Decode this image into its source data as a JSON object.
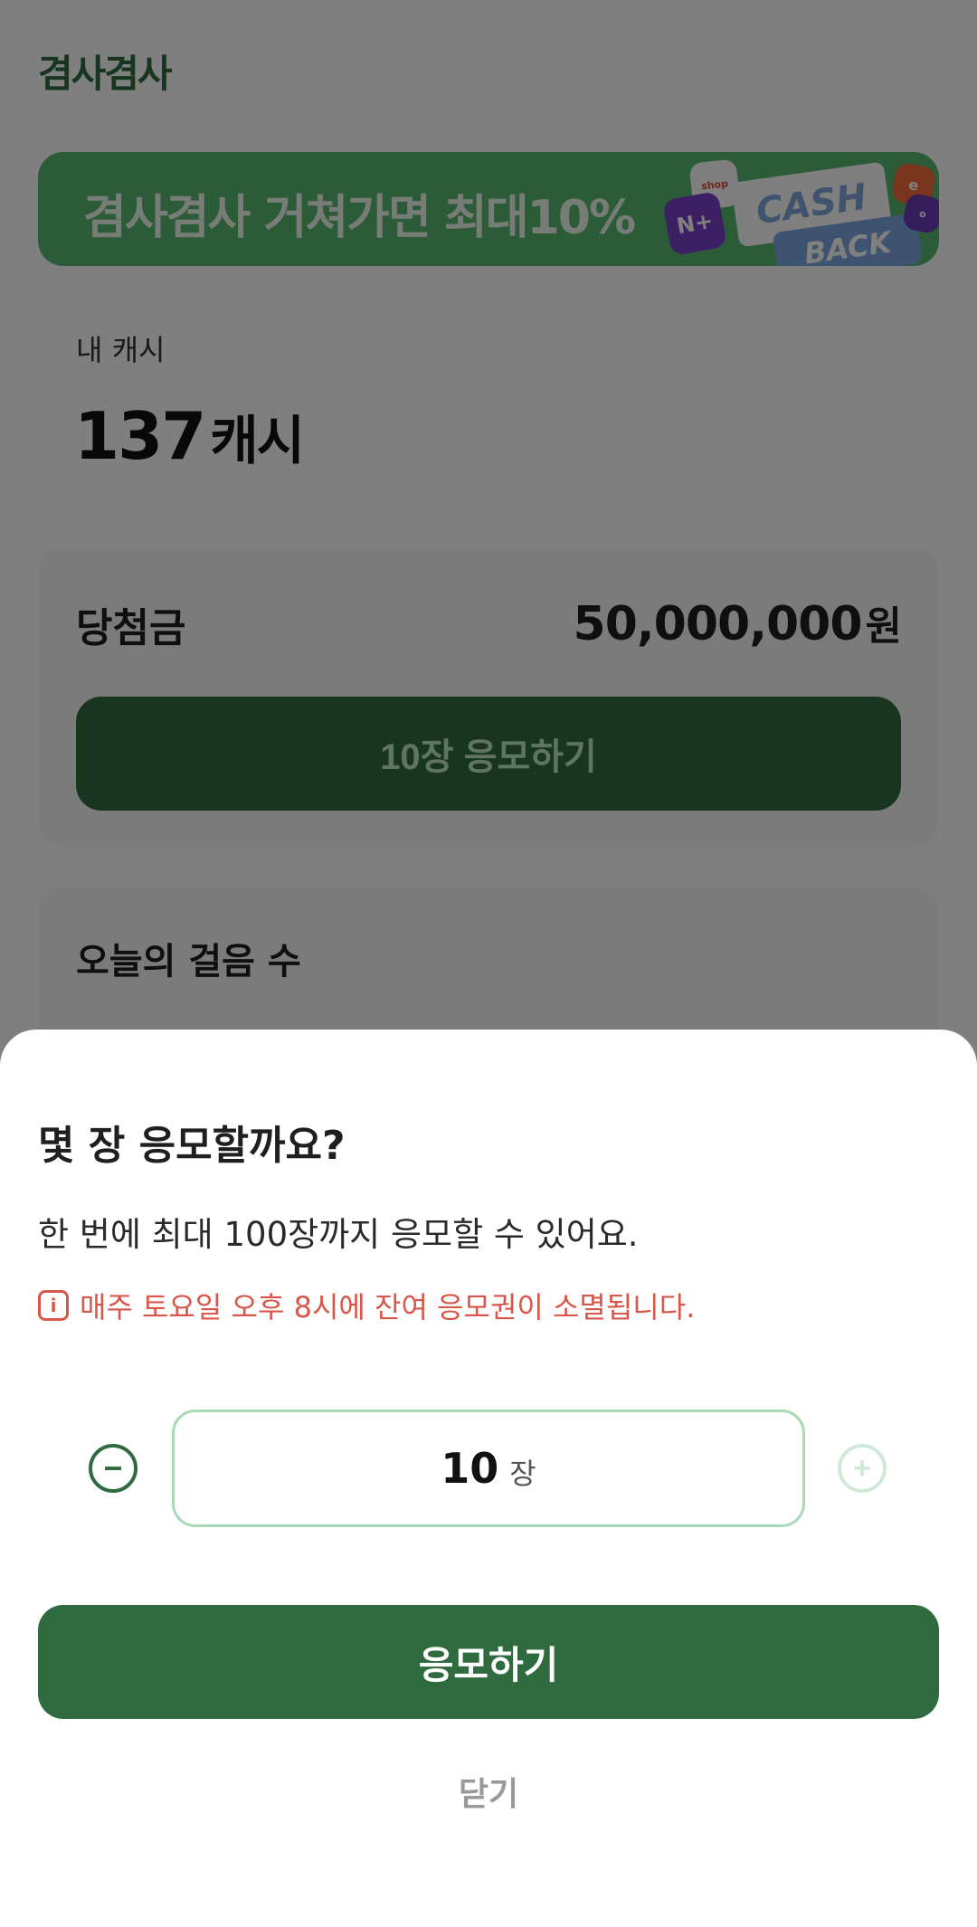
{
  "app": {
    "brand": "겸사겸사"
  },
  "banner": {
    "text": "겸사겸사 거쳐가면 최대10%",
    "cash_word": "CASH",
    "back_word": "BACK"
  },
  "cash": {
    "label": "내 캐시",
    "amount": "137",
    "unit": "캐시"
  },
  "prize": {
    "label": "당첨금",
    "amount": "50,000,000",
    "unit": "원",
    "button_label": "10장 응모하기"
  },
  "steps": {
    "label": "오늘의 걸음 수"
  },
  "sheet": {
    "title": "몇 장 응모할까요?",
    "description": "한 번에 최대 100장까지 응모할 수 있어요.",
    "warning": "매주 토요일 오후 8시에 잔여 응모권이 소멸됩니다.",
    "quantity": {
      "value": "10",
      "unit": "장",
      "max": 100
    },
    "submit_label": "응모하기",
    "close_label": "닫기"
  },
  "colors": {
    "primary": "#2f6b3f",
    "banner": "#57b66e",
    "warning": "#d9574a",
    "disabled": "#cfe9d6"
  }
}
